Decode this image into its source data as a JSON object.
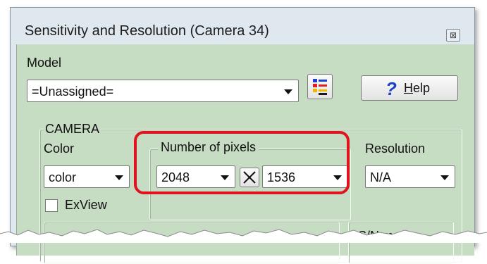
{
  "window": {
    "title": "Sensitivity and Resolution (Camera 34)",
    "close_glyph": "⊠"
  },
  "model": {
    "label": "Model",
    "selected": "=Unassigned=",
    "list_button_icon": "color-list-icon",
    "help_label": "Help",
    "help_mnemonic": "H",
    "help_rest": "elp",
    "help_icon": "question-mark-icon"
  },
  "camera": {
    "group_label": "CAMERA",
    "color": {
      "label": "Color",
      "selected": "color"
    },
    "pixels": {
      "group_label": "Number of pixels",
      "width": "2048",
      "height": "1536",
      "times_glyph": "✕"
    },
    "resolution": {
      "label": "Resolution",
      "selected": "N/A"
    },
    "exview": {
      "label": "ExView",
      "checked": false
    }
  },
  "bottom": {
    "sn_label": "S/N max"
  },
  "colors": {
    "highlight": "#e0141e",
    "pane": "#c6ddc3",
    "title_bg": "#dfe8ef"
  }
}
